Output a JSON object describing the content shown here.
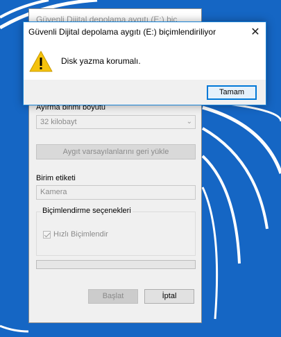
{
  "colors": {
    "accent": "#0078d7",
    "desktop": "#1566c4",
    "warning": "#f4c20d"
  },
  "format_window": {
    "title": "Güvenli Dijital depolama aygıtı (E:) biç",
    "allocation_label": "Ayırma birimi boyutu",
    "allocation_value": "32 kilobayt",
    "restore_defaults": "Aygıt varsayılanlarını geri yükle",
    "volume_label_caption": "Birim etiketi",
    "volume_label_value": "Kamera",
    "options_group": "Biçimlendirme seçenekleri",
    "quick_format": "Hızlı Biçimlendir",
    "quick_format_checked": true,
    "progress_fraction": 0,
    "start_button": "Başlat",
    "cancel_button": "İptal"
  },
  "dialog": {
    "title": "Güvenli Dijital depolama aygıtı (E:) biçimlendiriliyor",
    "icon": "warning-icon",
    "message": "Disk yazma korumalı.",
    "ok_button": "Tamam"
  }
}
